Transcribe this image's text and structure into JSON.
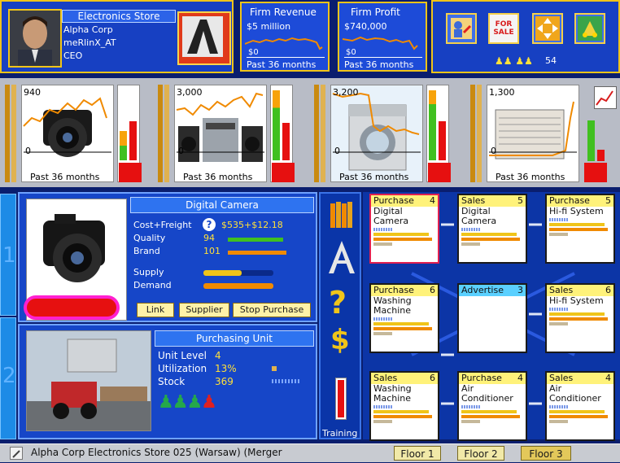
{
  "store": {
    "header": "Electronics Store",
    "company": "Alpha Corp",
    "player": "meRlinX_AT",
    "role": "CEO"
  },
  "revenue": {
    "title": "Firm Revenue",
    "value": "$5 million",
    "zero": "$0",
    "period": "Past 36 months"
  },
  "profit": {
    "title": "Firm Profit",
    "value": "$740,000",
    "zero": "$0",
    "period": "Past 36 months"
  },
  "toolbar": {
    "for_sale": "FOR SALE",
    "people_count": "54",
    "icons": [
      "manager-icon",
      "for-sale-icon",
      "move-icon",
      "build-icon"
    ]
  },
  "products": [
    {
      "name": "camera",
      "top_value": "940",
      "zero": "0",
      "period": "Past 36 months"
    },
    {
      "name": "hifi",
      "top_value": "3,000",
      "zero": "0",
      "period": "Past 36 months"
    },
    {
      "name": "washer",
      "top_value": "3,200",
      "zero": "0",
      "period": "Past 36 months"
    },
    {
      "name": "aircon",
      "top_value": "1,300",
      "zero": "0",
      "period": "Past 36 months"
    }
  ],
  "detail": {
    "title": "Digital Camera",
    "cost_label": "Cost+Freight",
    "cost_value": "$535+$12.18",
    "quality_label": "Quality",
    "quality_value": "94",
    "brand_label": "Brand",
    "brand_value": "101",
    "supply_label": "Supply",
    "demand_label": "Demand",
    "buttons": {
      "link": "Link",
      "supplier": "Supplier",
      "stop": "Stop Purchase"
    },
    "help": "?"
  },
  "unit": {
    "title": "Purchasing Unit",
    "level_label": "Unit Level",
    "level_value": "4",
    "util_label": "Utilization",
    "util_value": "13%",
    "stock_label": "Stock",
    "stock_value": "369"
  },
  "tools": {
    "help": "?",
    "money": "$",
    "training": "Training"
  },
  "side_tabs": [
    "1",
    "2"
  ],
  "cards": [
    {
      "type": "Purchase",
      "num": "4",
      "line1": "Digital",
      "line2": "Camera",
      "hdr": "#fff27a"
    },
    {
      "type": "Sales",
      "num": "5",
      "line1": "Digital",
      "line2": "Camera",
      "hdr": "#fff27a"
    },
    {
      "type": "Purchase",
      "num": "5",
      "line1": "Hi-fi System",
      "line2": "",
      "hdr": "#fff27a"
    },
    {
      "type": "Purchase",
      "num": "6",
      "line1": "Washing",
      "line2": "Machine",
      "hdr": "#fff27a"
    },
    {
      "type": "Advertise",
      "num": "3",
      "line1": "",
      "line2": "",
      "hdr": "#5ad0ff"
    },
    {
      "type": "Sales",
      "num": "6",
      "line1": "Hi-fi System",
      "line2": "",
      "hdr": "#fff27a"
    },
    {
      "type": "Sales",
      "num": "6",
      "line1": "Washing",
      "line2": "Machine",
      "hdr": "#fff27a"
    },
    {
      "type": "Purchase",
      "num": "4",
      "line1": "Air",
      "line2": "Conditioner",
      "hdr": "#fff27a"
    },
    {
      "type": "Sales",
      "num": "4",
      "line1": "Air",
      "line2": "Conditioner",
      "hdr": "#fff27a"
    }
  ],
  "status": {
    "text": "Alpha Corp Electronics Store 025 (Warsaw) (Merger",
    "floors": [
      "Floor 1",
      "Floor 2",
      "Floor 3"
    ]
  },
  "colors": {
    "accent": "#f0c419",
    "panel": "#1d3fc8",
    "chart_line": "#f08a00",
    "alert": "#e61010"
  }
}
